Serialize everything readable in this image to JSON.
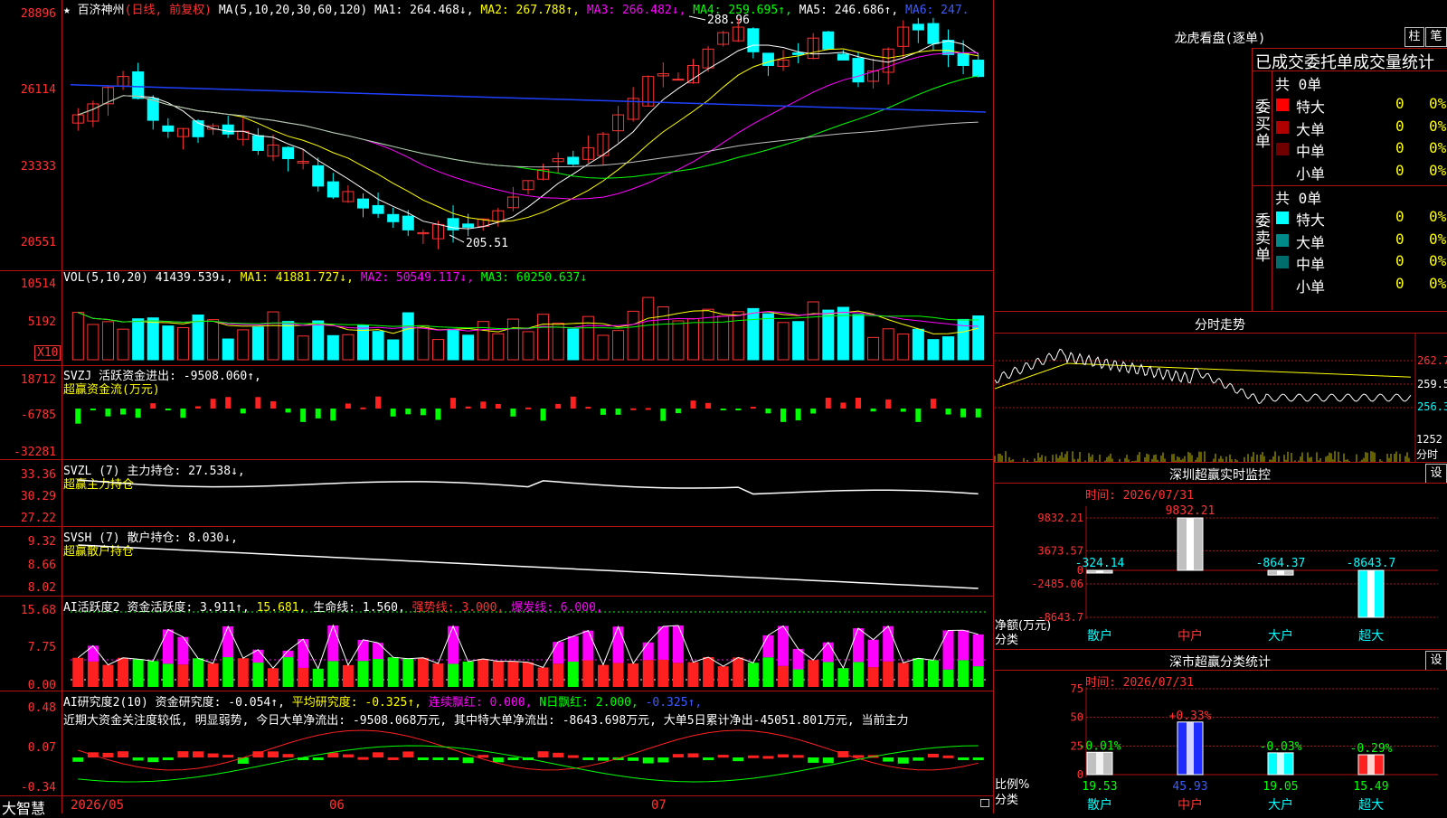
{
  "main_chart": {
    "title_star": "★",
    "stock_name": "百济神州",
    "period": "(日线, 前复权)",
    "ma_legend": {
      "label": "MA(5,10,20,30,60,120)",
      "ma1": "MA1: 264.468↓,",
      "ma2": "MA2: 267.788↑,",
      "ma3": "MA3: 266.482↓,",
      "ma4": "MA4: 259.695↑,",
      "ma5": "MA5: 246.686↑,",
      "ma6": "MA6: 247."
    },
    "y_ticks": [
      "28896",
      "26114",
      "23333",
      "20551"
    ],
    "high_marker": "288.96",
    "low_marker": "205.51"
  },
  "vol_panel": {
    "legend_label": "VOL(5,10,20)",
    "vol": "41439.539↓,",
    "ma1": "MA1: 41881.727↓,",
    "ma2": "MA2: 50549.117↓,",
    "ma3": "MA3: 60250.637↓",
    "y_ticks": [
      "10514",
      "5192"
    ],
    "unit_badge": "X10"
  },
  "svzj_panel": {
    "legend_label": "SVZJ",
    "legend_value": "活跃资金进出: -9508.060↑,",
    "sub_label": "超赢资金流(万元)",
    "y_ticks": [
      "18712",
      "-6785",
      "-32281"
    ]
  },
  "svzl_panel": {
    "legend_label": "SVZL (7)",
    "legend_value": "主力持仓: 27.538↓,",
    "sub_label": "超赢主力持仓",
    "y_ticks": [
      "33.36",
      "30.29",
      "27.22"
    ]
  },
  "svsh_panel": {
    "legend_label": "SVSH (7)",
    "legend_value": "散户持仓: 8.030↓,",
    "sub_label": "超赢散户持仓",
    "y_ticks": [
      "9.32",
      "8.66",
      "8.02"
    ]
  },
  "ai_active_panel": {
    "legend_label": "AI活跃度2",
    "v1": "资金活跃度: 3.911↑,",
    "v2": "15.681,",
    "v3": "生命线: 1.560,",
    "v4": "强势线: 3.000,",
    "v5": "爆发线: 6.000,",
    "y_ticks": [
      "15.68",
      "7.75",
      "0.00"
    ]
  },
  "ai_research_panel": {
    "legend_label": "AI研究度2(10)",
    "v1": "资金研究度: -0.054↑,",
    "v2": "平均研究度: -0.325↑,",
    "v3": "连续飘红: 0.000,",
    "v4": "N日飘红: 2.000,",
    "v5": "-0.325↑,",
    "commentary": "近期大资金关注度较低, 明显弱势, 今日大单净流出: -9508.068万元, 其中特大单净流出: -8643.698万元, 大单5日累计净出-45051.801万元, 当前主力",
    "y_ticks": [
      "0.48",
      "0.07",
      "-0.34"
    ]
  },
  "x_axis": {
    "labels": [
      "2026/05",
      "06",
      "07"
    ],
    "brand": "大智慧"
  },
  "dragon_tiger": {
    "title": "龙虎看盘(逐单)",
    "btn_bar": "柱",
    "btn_pen": "笔",
    "header": "已成交委托单成交量统计",
    "buy_label": "委买单",
    "sell_label": "委卖单",
    "buy_total": "共 0单",
    "sell_total": "共 0单",
    "buy_rows": [
      {
        "name": "特大",
        "count": "0",
        "pct": "0%",
        "color": "#ff0000"
      },
      {
        "name": "大单",
        "count": "0",
        "pct": "0%",
        "color": "#b00000"
      },
      {
        "name": "中单",
        "count": "0",
        "pct": "0%",
        "color": "#700000"
      },
      {
        "name": "小单",
        "count": "0",
        "pct": "0%",
        "color": ""
      }
    ],
    "sell_rows": [
      {
        "name": "特大",
        "count": "0",
        "pct": "0%",
        "color": "#00ffff"
      },
      {
        "name": "大单",
        "count": "0",
        "pct": "0%",
        "color": "#008b8b"
      },
      {
        "name": "中单",
        "count": "0",
        "pct": "0%",
        "color": "#006c6c"
      },
      {
        "name": "小单",
        "count": "0",
        "pct": "0%",
        "color": ""
      }
    ]
  },
  "intraday": {
    "title": "分时走势",
    "y_ticks": [
      "262.7",
      "259.5",
      "256.3"
    ],
    "vol_tick": "1252",
    "vol_label": "分时"
  },
  "sz_monitor": {
    "title": "深圳超赢实时监控",
    "set_btn": "设",
    "time": "时间: 2026/07/31",
    "y_ticks": [
      "9832.21",
      "3673.57",
      "0",
      "-2485.06",
      "-8643.7"
    ],
    "y_label": "净额(万元)",
    "x_label": "分类",
    "categories": [
      "散户",
      "中户",
      "大户",
      "超大"
    ],
    "values": [
      -324.14,
      9832.21,
      -864.37,
      -8643.7
    ],
    "value_labels": [
      "-324.14",
      "9832.21",
      "-864.37",
      "-8643.7"
    ]
  },
  "sz_stats": {
    "title": "深市超赢分类统计",
    "set_btn": "设",
    "time": "时间: 2026/07/31",
    "y_ticks": [
      "75",
      "50",
      "25",
      "0"
    ],
    "y_label": "比例%",
    "x_label": "分类",
    "categories": [
      "散户",
      "中户",
      "大户",
      "超大"
    ],
    "values": [
      19.53,
      45.93,
      19.05,
      15.49
    ],
    "value_labels": [
      "19.53",
      "45.93",
      "19.05",
      "15.49"
    ],
    "change_labels": [
      "-0.01%",
      "+0.33%",
      "-0.03%",
      "-0.29%"
    ]
  }
}
